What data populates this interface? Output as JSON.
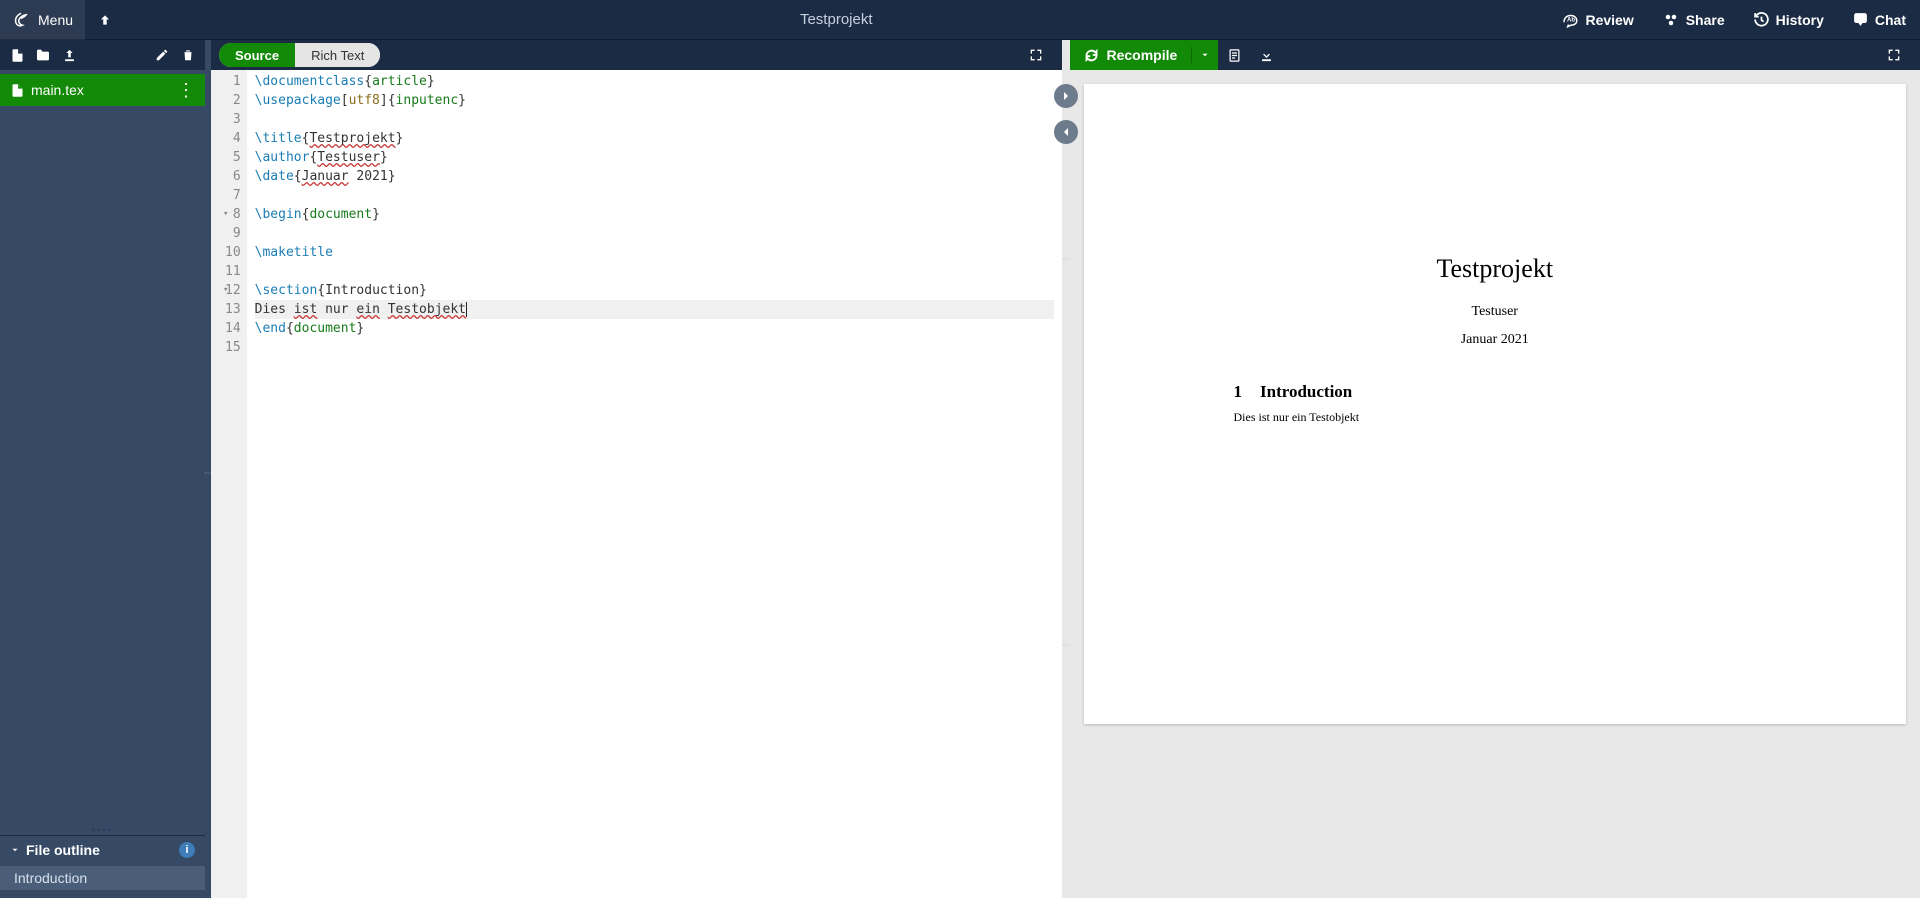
{
  "topbar": {
    "menu_label": "Menu",
    "project_title": "Testprojekt",
    "review_label": "Review",
    "share_label": "Share",
    "history_label": "History",
    "chat_label": "Chat"
  },
  "editor_modes": {
    "source_label": "Source",
    "richtext_label": "Rich Text"
  },
  "files": {
    "main_file": "main.tex"
  },
  "outline": {
    "header": "File outline",
    "items": [
      "Introduction"
    ]
  },
  "compile": {
    "recompile_label": "Recompile"
  },
  "code_lines": [
    {
      "n": 1,
      "fold": false,
      "segments": [
        [
          "cmd",
          "\\documentclass"
        ],
        [
          "brace",
          "{"
        ],
        [
          "arg",
          "article"
        ],
        [
          "brace",
          "}"
        ]
      ]
    },
    {
      "n": 2,
      "fold": false,
      "segments": [
        [
          "cmd",
          "\\usepackage"
        ],
        [
          "brace",
          "["
        ],
        [
          "opt",
          "utf8"
        ],
        [
          "brace",
          "]{"
        ],
        [
          "arg",
          "inputenc"
        ],
        [
          "brace",
          "}"
        ]
      ]
    },
    {
      "n": 3,
      "fold": false,
      "segments": []
    },
    {
      "n": 4,
      "fold": false,
      "segments": [
        [
          "cmd",
          "\\title"
        ],
        [
          "brace",
          "{"
        ],
        [
          "textspell",
          "Testprojekt"
        ],
        [
          "brace",
          "}"
        ]
      ]
    },
    {
      "n": 5,
      "fold": false,
      "segments": [
        [
          "cmd",
          "\\author"
        ],
        [
          "brace",
          "{"
        ],
        [
          "textspell",
          "Testuser"
        ],
        [
          "brace",
          "}"
        ]
      ]
    },
    {
      "n": 6,
      "fold": false,
      "segments": [
        [
          "cmd",
          "\\date"
        ],
        [
          "brace",
          "{"
        ],
        [
          "textspell",
          "Januar"
        ],
        [
          "text",
          " 2021"
        ],
        [
          "brace",
          "}"
        ]
      ]
    },
    {
      "n": 7,
      "fold": false,
      "segments": []
    },
    {
      "n": 8,
      "fold": true,
      "segments": [
        [
          "cmd",
          "\\begin"
        ],
        [
          "brace",
          "{"
        ],
        [
          "arg",
          "document"
        ],
        [
          "brace",
          "}"
        ]
      ]
    },
    {
      "n": 9,
      "fold": false,
      "segments": []
    },
    {
      "n": 10,
      "fold": false,
      "segments": [
        [
          "cmd",
          "\\maketitle"
        ]
      ]
    },
    {
      "n": 11,
      "fold": false,
      "segments": []
    },
    {
      "n": 12,
      "fold": true,
      "segments": [
        [
          "cmd",
          "\\section"
        ],
        [
          "brace",
          "{"
        ],
        [
          "text",
          "Introduction"
        ],
        [
          "brace",
          "}"
        ]
      ]
    },
    {
      "n": 13,
      "fold": false,
      "hl": true,
      "segments": [
        [
          "text",
          "Dies "
        ],
        [
          "textspell",
          "ist"
        ],
        [
          "text",
          " nur "
        ],
        [
          "textspell",
          "ein"
        ],
        [
          "text",
          " "
        ],
        [
          "textspell",
          "Testobjekt"
        ],
        [
          "cursor",
          ""
        ]
      ]
    },
    {
      "n": 14,
      "fold": false,
      "segments": [
        [
          "cmd",
          "\\end"
        ],
        [
          "brace",
          "{"
        ],
        [
          "arg",
          "document"
        ],
        [
          "brace",
          "}"
        ]
      ]
    },
    {
      "n": 15,
      "fold": false,
      "segments": []
    }
  ],
  "pdf": {
    "title": "Testprojekt",
    "author": "Testuser",
    "date": "Januar 2021",
    "section_num": "1",
    "section_title": "Introduction",
    "body": "Dies ist nur ein Testobjekt"
  }
}
